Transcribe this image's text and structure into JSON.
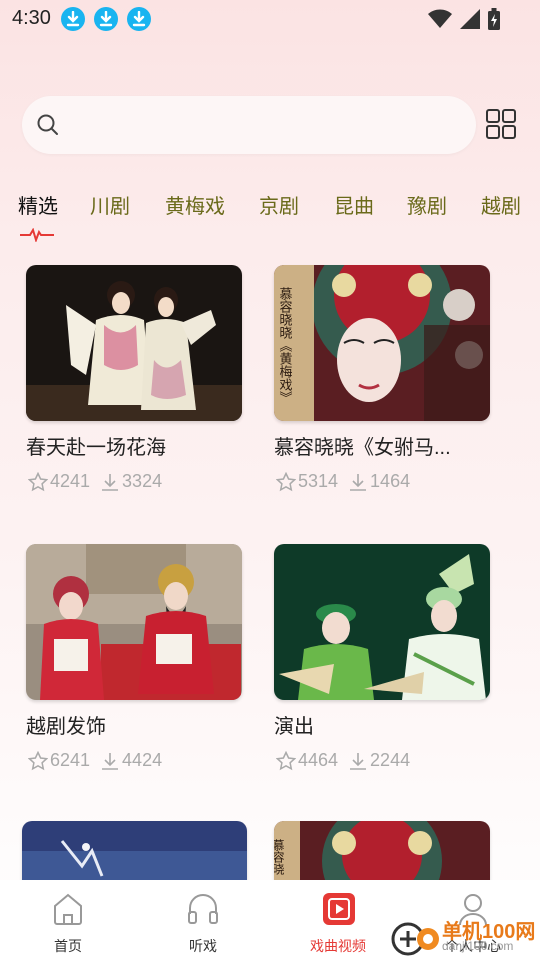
{
  "status_bar": {
    "time": "4:30"
  },
  "search": {
    "placeholder": ""
  },
  "tabs": [
    {
      "label": "精选",
      "active": true
    },
    {
      "label": "川剧"
    },
    {
      "label": "黄梅戏"
    },
    {
      "label": "京剧"
    },
    {
      "label": "昆曲"
    },
    {
      "label": "豫剧"
    },
    {
      "label": "越剧"
    }
  ],
  "cards": [
    {
      "title": "春天赴一场花海",
      "likes": "4241",
      "downloads": "3324"
    },
    {
      "title": "慕容晓晓《女驸马...",
      "likes": "5314",
      "downloads": "1464",
      "poster_text": "慕容晓晓《黄梅戏》"
    },
    {
      "title": "越剧发饰",
      "likes": "6241",
      "downloads": "4424"
    },
    {
      "title": "演出",
      "likes": "4464",
      "downloads": "2244"
    },
    {
      "title": "",
      "likes": "",
      "downloads": ""
    },
    {
      "title": "",
      "likes": "",
      "downloads": "",
      "poster_text": "慕容晓"
    }
  ],
  "bottom_nav": [
    {
      "label": "首页",
      "icon": "home-icon"
    },
    {
      "label": "听戏",
      "icon": "headphones-icon"
    },
    {
      "label": "戏曲视频",
      "icon": "video-play-icon",
      "active": true
    },
    {
      "label": "个人中心",
      "icon": "user-icon"
    }
  ],
  "watermark": {
    "text": "单机100网",
    "sub": "danji100.com"
  },
  "colors": {
    "accent": "#e53935",
    "tab_text": "#6a6a1a",
    "download_badge": "#19b4f0"
  }
}
